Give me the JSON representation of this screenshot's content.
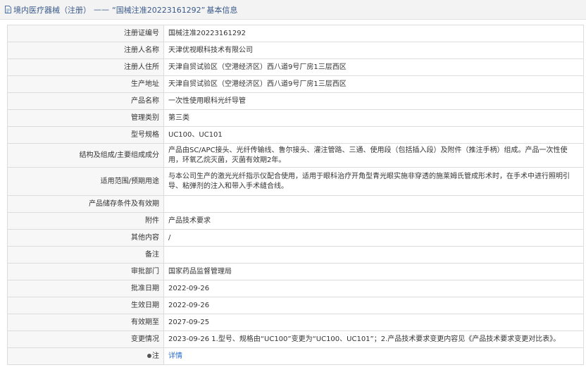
{
  "header": {
    "crumb1": "境内医疗器械（注册）",
    "dash": "——",
    "crumb2": "“国械注准20223161292”",
    "crumb3": "基本信息"
  },
  "rows": [
    {
      "label": "注册证编号",
      "value": "国械注准20223161292"
    },
    {
      "label": "注册人名称",
      "value": "天津优视眼科技术有限公司"
    },
    {
      "label": "注册人住所",
      "value": "天津自贸试验区（空港经济区）西八道9号厂房1三层西区"
    },
    {
      "label": "生产地址",
      "value": "天津自贸试验区（空港经济区）西八道9号厂房1三层西区"
    },
    {
      "label": "产品名称",
      "value": "一次性使用眼科光纤导管"
    },
    {
      "label": "管理类别",
      "value": "第三类"
    },
    {
      "label": "型号规格",
      "value": "UC100、UC101"
    },
    {
      "label": "结构及组成/主要组成成分",
      "value": "产品由SC/APC接头、光纤传输线、鲁尔接头、灌注管路、三通、使用段（包括插入段）及附件（推注手柄）组成。产品一次性使用，环氧乙烷灭菌，灭菌有效期2年。"
    },
    {
      "label": "适用范围/预期用途",
      "value": "与本公司生产的激光光纤指示仪配合使用，适用于眼科治疗开角型青光眼实施非穿透的施莱姆氏管成形术时，在手术中进行照明引导、粘弹剂的注入和带入手术缝合线。"
    },
    {
      "label": "产品储存条件及有效期",
      "value": ""
    },
    {
      "label": "附件",
      "value": "产品技术要求"
    },
    {
      "label": "其他内容",
      "value": "/"
    },
    {
      "label": "备注",
      "value": ""
    },
    {
      "label": "审批部门",
      "value": "国家药品监督管理局"
    },
    {
      "label": "批准日期",
      "value": "2022-09-26"
    },
    {
      "label": "生效日期",
      "value": "2022-09-26"
    },
    {
      "label": "有效期至",
      "value": "2027-09-25"
    },
    {
      "label": "变更情况",
      "value": "2023-09-26 1.型号、规格由“UC100”变更为“UC100、UC101”；2.产品技术要求变更内容见《产品技术要求变更对比表》。"
    }
  ],
  "note_row": {
    "label": "注",
    "link": "详情",
    "icon": "note-icon"
  }
}
